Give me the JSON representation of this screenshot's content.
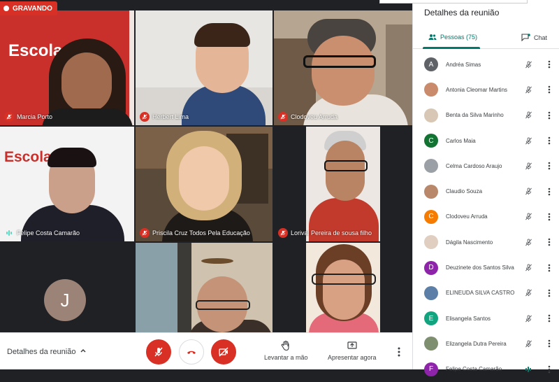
{
  "recording": {
    "label": "GRAVANDO"
  },
  "tiles": [
    {
      "name": "Marcia Porto",
      "muted": true,
      "banner": "Escola"
    },
    {
      "name": "Herbert Lima",
      "muted": true
    },
    {
      "name": "Clodoveu Arruda",
      "muted": true
    },
    {
      "name": "Felipe Costa Camarão",
      "muted": false,
      "banner": "Escola"
    },
    {
      "name": "Priscila Cruz Todos Pela Educação",
      "muted": true
    },
    {
      "name": "Lorival Pereira de sousa filho",
      "muted": true
    },
    {
      "name": "",
      "initial": "J"
    },
    {
      "name": ""
    },
    {
      "name": ""
    }
  ],
  "toolbar": {
    "details_label": "Detalhes da reunião",
    "raise_hand_label": "Levantar a mão",
    "present_label": "Apresentar agora"
  },
  "panel": {
    "title": "Detalhes da reunião",
    "people_tab": "Pessoas (75)",
    "chat_tab": "Chat",
    "participants": [
      {
        "name": "Andréa Simas",
        "initial": "A",
        "color": "#5f6368"
      },
      {
        "name": "Antonia Cleomar Martins",
        "initial": "",
        "color": "#c98b6b"
      },
      {
        "name": "Benta da Silva Marinho",
        "initial": "",
        "color": "#d9c7b5"
      },
      {
        "name": "Carlos Maia",
        "initial": "C",
        "color": "#137333"
      },
      {
        "name": "Celma Cardoso Araujo",
        "initial": "",
        "color": "#9aa0a6"
      },
      {
        "name": "Claudio Souza",
        "initial": "",
        "color": "#b9876a"
      },
      {
        "name": "Clodoveu Arruda",
        "initial": "C",
        "color": "#f57c00"
      },
      {
        "name": "Dágila Nascimento",
        "initial": "",
        "color": "#e0cfc0"
      },
      {
        "name": "Deuzinete dos Santos Silva",
        "initial": "D",
        "color": "#8e24aa"
      },
      {
        "name": "ELINEUDA SILVA CASTRO",
        "initial": "",
        "color": "#5c7fa8"
      },
      {
        "name": "Elisangela Santos",
        "initial": "E",
        "color": "#12a37f"
      },
      {
        "name": "Elizangela Dutra Pereira",
        "initial": "",
        "color": "#7d8f6e"
      },
      {
        "name": "Felipe Costa Camarão",
        "initial": "F",
        "color": "#8e24aa"
      }
    ]
  },
  "colors": {
    "accent": "#00796b",
    "danger": "#d93025"
  }
}
